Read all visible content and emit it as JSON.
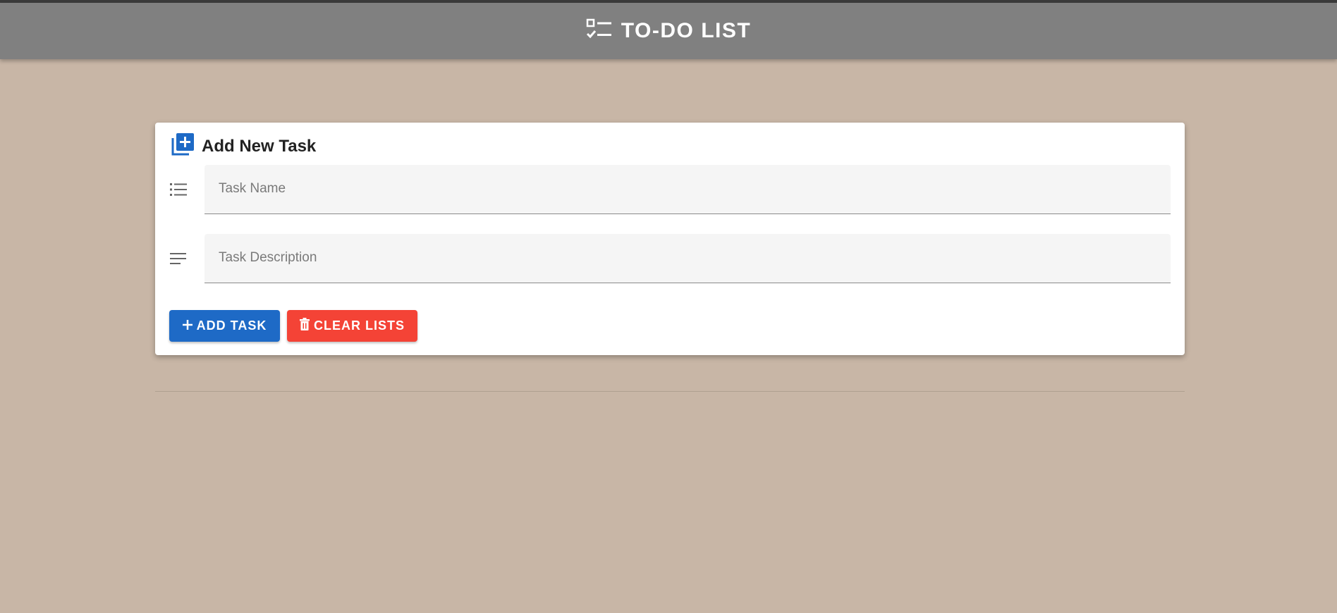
{
  "appbar": {
    "title": "TO-DO LIST",
    "icon": "checklist-icon"
  },
  "form": {
    "title": "Add New Task",
    "title_icon": "add-box-icon",
    "task_name": {
      "placeholder": "Task Name",
      "value": "",
      "icon": "list-icon"
    },
    "task_description": {
      "placeholder": "Task Description",
      "value": "",
      "icon": "notes-icon"
    },
    "add_button": {
      "label": "ADD TASK",
      "icon": "plus-icon"
    },
    "clear_button": {
      "label": "CLEAR LISTS",
      "icon": "trash-icon"
    }
  },
  "colors": {
    "background": "#c8b6a6",
    "appbar": "#808080",
    "primary": "#1e6ac6",
    "danger": "#f44336"
  }
}
